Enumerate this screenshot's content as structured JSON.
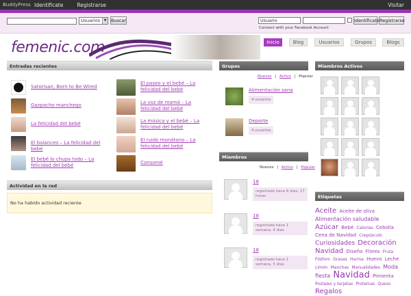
{
  "adminbar": {
    "brand": "BuddyPress",
    "items": [
      "Identificate",
      "Registrarse"
    ],
    "right": "Visitar"
  },
  "search": {
    "value": "",
    "select": "Usuarios",
    "button": "Buscar"
  },
  "login": {
    "user_value": "Usuario",
    "password_value": "",
    "login_button": "Identificate",
    "register_button": "Registrarse",
    "facebook": "Connect with your Facebook Account"
  },
  "logo": "femenic.com",
  "nav": [
    "Inicio",
    "Blog",
    "Usuarios",
    "Grupos",
    "Blogs"
  ],
  "recent": {
    "title": "Entradas recientes",
    "left": [
      "Satorisan, Born to Be Wired",
      "Gazpacho manchego",
      "La felicidad del bebé",
      "El balanceo – La felicidad del bebé",
      "El bebé lo chupa todo – La felicidad del bebé"
    ],
    "right": [
      "El paseo y el bebé – La felicidad del bebé",
      "La voz de mamá – La felicidad del bebé",
      "La música y el bebé – La felicidad del bebé",
      "El ruido monótono – La felicidad del bebé",
      "Consomé"
    ]
  },
  "activity": {
    "title": "Actividad en la red",
    "empty": "No ha habido actividad reciente"
  },
  "groups": {
    "title": "Grupos",
    "tabs": [
      "Nuevos",
      "|",
      "Activo",
      "|",
      "Popular"
    ],
    "items": [
      {
        "name": "Alimentación sana",
        "meta": "4 usuarios"
      },
      {
        "name": "Deporte",
        "meta": "4 usuarios"
      }
    ]
  },
  "members": {
    "title": "Miembros",
    "tabs": [
      "Nuevos",
      "|",
      "Activo",
      "|",
      "Popular"
    ],
    "items": [
      {
        "name": "18",
        "meta": "registrado hace 6 días, 17 horas"
      },
      {
        "name": "18",
        "meta": "registrado hace 1 semana, 4 días"
      },
      {
        "name": "18",
        "meta": "registrado hace 1 semana, 5 días"
      }
    ]
  },
  "active_members": {
    "title": "Miembros Activos"
  },
  "tags": {
    "title": "Etiquetas",
    "items": [
      {
        "t": "Aceite",
        "s": 10
      },
      {
        "t": "Aceite de oliva",
        "s": 7
      },
      {
        "t": "Alimentación saludable",
        "s": 8
      },
      {
        "t": "Azúcar",
        "s": 10
      },
      {
        "t": "Bebé",
        "s": 7
      },
      {
        "t": "Calorías",
        "s": 6
      },
      {
        "t": "Cebolla",
        "s": 7
      },
      {
        "t": "Cena de Navidad",
        "s": 7
      },
      {
        "t": "Crepúsculo",
        "s": 6
      },
      {
        "t": "Curiosidades",
        "s": 9
      },
      {
        "t": "Decoración",
        "s": 10
      },
      {
        "t": "Navidad",
        "s": 10
      },
      {
        "t": "Diseño",
        "s": 7
      },
      {
        "t": "Flores",
        "s": 7
      },
      {
        "t": "Fruta",
        "s": 6
      },
      {
        "t": "Fósforo",
        "s": 6
      },
      {
        "t": "Grasas",
        "s": 6
      },
      {
        "t": "Harina",
        "s": 6
      },
      {
        "t": "Huevo",
        "s": 7
      },
      {
        "t": "Leche",
        "s": 7
      },
      {
        "t": "Limón",
        "s": 6
      },
      {
        "t": "Manchas",
        "s": 6
      },
      {
        "t": "Manualidades",
        "s": 6
      },
      {
        "t": "Moda fiesta",
        "s": 8
      },
      {
        "t": "Navidad",
        "s": 13
      },
      {
        "t": "Pimienta",
        "s": 7
      },
      {
        "t": "Postales y tarjetas",
        "s": 6
      },
      {
        "t": "Proteínas",
        "s": 6
      },
      {
        "t": "Queso",
        "s": 6
      },
      {
        "t": "Regalos",
        "s": 10
      }
    ]
  },
  "colors": {
    "accent": "#a83bbf",
    "strip": "#9a34b4",
    "link": "#a33ab5"
  }
}
